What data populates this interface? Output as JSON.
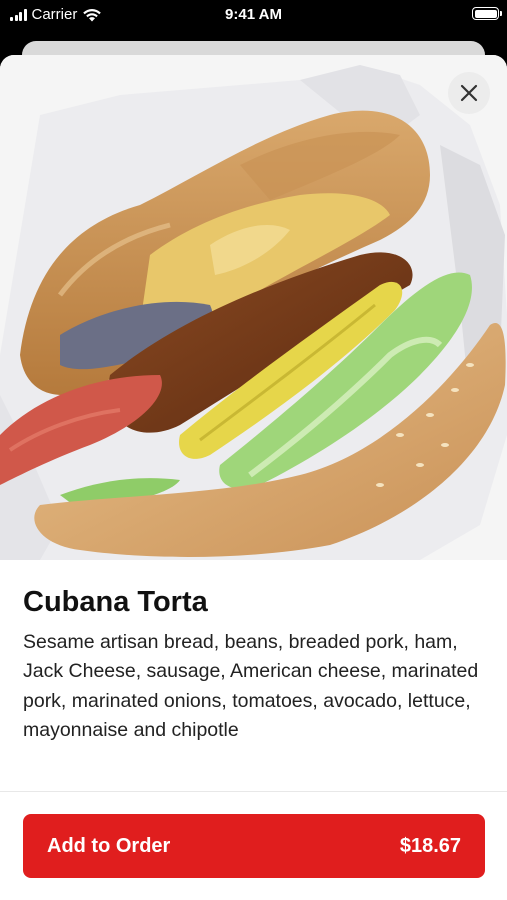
{
  "status_bar": {
    "carrier": "Carrier",
    "time": "9:41 AM",
    "icons": [
      "signal-icon",
      "wifi-icon",
      "battery-icon"
    ]
  },
  "item": {
    "image": "sandwich-photo",
    "title": "Cubana Torta",
    "description": "Sesame artisan bread, beans, breaded pork, ham, Jack Cheese, sausage, American cheese, marinated pork, marinated onions, tomatoes, avocado, lettuce, mayonnaise and chipotle"
  },
  "close_button": {
    "icon": "close-icon"
  },
  "order_button": {
    "label": "Add to Order",
    "price": "$18.67"
  },
  "colors": {
    "accent": "#e01e1e",
    "background": "#ffffff",
    "status_bar": "#000000"
  }
}
